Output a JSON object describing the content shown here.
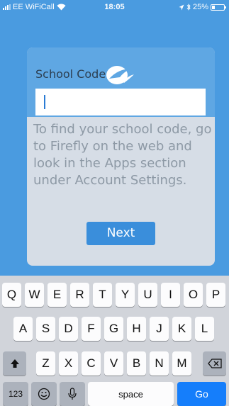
{
  "status_bar": {
    "carrier": "EE WiFiCall",
    "time": "18:05",
    "battery": "25%",
    "battery_level": 0.25
  },
  "card": {
    "title": "School Code",
    "input_value": "",
    "help_text": "To find your school code, go to Firefly on the web and look in the Apps section under Account Settings.",
    "next_label": "Next"
  },
  "keyboard": {
    "row1": [
      "Q",
      "W",
      "E",
      "R",
      "T",
      "Y",
      "U",
      "I",
      "O",
      "P"
    ],
    "row2": [
      "A",
      "S",
      "D",
      "F",
      "G",
      "H",
      "J",
      "K",
      "L"
    ],
    "row3": [
      "Z",
      "X",
      "C",
      "V",
      "B",
      "N",
      "M"
    ],
    "numbers_label": "123",
    "space_label": "space",
    "go_label": "Go"
  },
  "colors": {
    "background": "#4a9be0",
    "header": "#5fa7e3",
    "button": "#3a8edb",
    "go_key": "#157efb"
  }
}
